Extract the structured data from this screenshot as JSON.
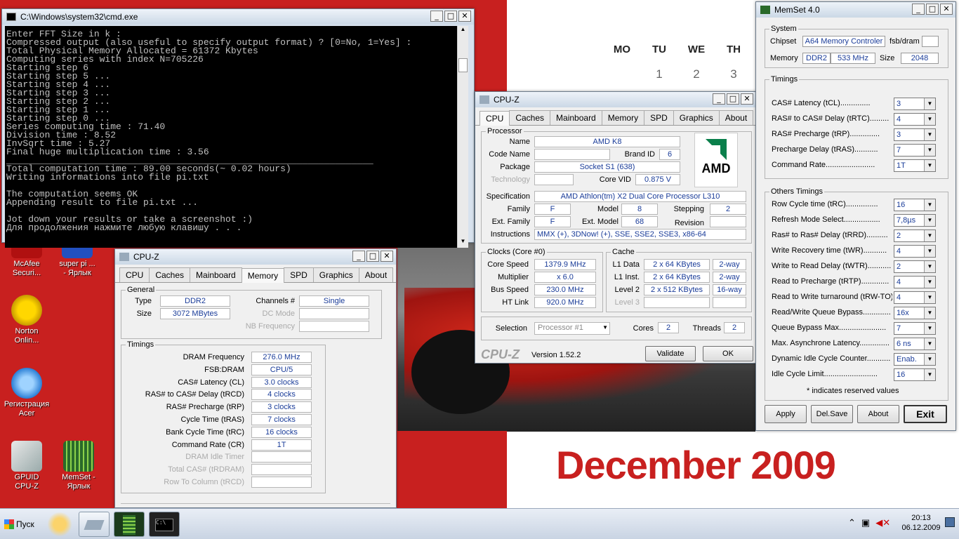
{
  "wallpaper": {
    "calendar": {
      "days": [
        "MO",
        "TU",
        "WE",
        "TH"
      ],
      "row1": [
        "1",
        "2",
        "3"
      ],
      "month": "December 2009"
    }
  },
  "desktop_icons": [
    {
      "label": "McAfee\nSecuri...",
      "icon": "mcafee-icon"
    },
    {
      "label": "super pi ...\n- Ярлык",
      "icon": "superpi-icon"
    },
    {
      "label": "Norton\nOnlin...",
      "icon": "norton-icon"
    },
    {
      "label": "Регистрация\nAcer",
      "icon": "acer-registration-icon"
    },
    {
      "label": "GPUID\nCPU-Z",
      "icon": "cpuz-icon"
    },
    {
      "label": "MemSet -\nЯрлык",
      "icon": "memset-icon"
    }
  ],
  "cmd": {
    "title": "C:\\Windows\\system32\\cmd.exe",
    "text": "Enter FFT Size in k :\nCompressed output (also useful to specify output format) ? [0=No, 1=Yes] :\nTotal Physical Memory Allocated = 61372 Kbytes\nComputing series with index N=705226\nStarting step 6\nStarting step 5 ...\nStarting step 4 ...\nStarting step 3 ...\nStarting step 2 ...\nStarting step 1 ...\nStarting step 0 ...\nSeries computing time : 71.40\nDivision time : 8.52\nInvSqrt time : 5.27\nFinal huge multiplication time : 3.56\n___________________________________________________________________\nTotal computation time : 89.00 seconds(~ 0.02 hours)\nWriting informations into file pi.txt\n\nThe computation seems OK\nAppending result to file pi.txt ...\n\nJot down your results or take a screenshot :)\nДля продолжения нажмите любую клавишу . . ."
  },
  "cpuz_mem": {
    "title": "CPU-Z",
    "tabs": [
      "CPU",
      "Caches",
      "Mainboard",
      "Memory",
      "SPD",
      "Graphics",
      "About"
    ],
    "active_tab": "Memory",
    "general_legend": "General",
    "type_label": "Type",
    "type": "DDR2",
    "size_label": "Size",
    "size": "3072 MBytes",
    "channels_label": "Channels #",
    "channels": "Single",
    "dcmode_label": "DC Mode",
    "nbfreq_label": "NB Frequency",
    "timings_legend": "Timings",
    "timings": [
      {
        "label": "DRAM Frequency",
        "value": "276.0 MHz"
      },
      {
        "label": "FSB:DRAM",
        "value": "CPU/5"
      },
      {
        "label": "CAS# Latency (CL)",
        "value": "3.0 clocks"
      },
      {
        "label": "RAS# to CAS# Delay (tRCD)",
        "value": "4 clocks"
      },
      {
        "label": "RAS# Precharge (tRP)",
        "value": "3 clocks"
      },
      {
        "label": "Cycle Time (tRAS)",
        "value": "7 clocks"
      },
      {
        "label": "Bank Cycle Time (tRC)",
        "value": "16 clocks"
      },
      {
        "label": "Command Rate (CR)",
        "value": "1T"
      },
      {
        "label": "DRAM Idle Timer",
        "value": ""
      },
      {
        "label": "Total CAS# (tRDRAM)",
        "value": ""
      },
      {
        "label": "Row To Column (tRCD)",
        "value": ""
      }
    ]
  },
  "cpuz_cpu": {
    "title": "CPU-Z",
    "tabs": [
      "CPU",
      "Caches",
      "Mainboard",
      "Memory",
      "SPD",
      "Graphics",
      "About"
    ],
    "active_tab": "CPU",
    "processor_legend": "Processor",
    "name_label": "Name",
    "name": "AMD K8",
    "codename_label": "Code Name",
    "brandid_label": "Brand ID",
    "brandid": "6",
    "package_label": "Package",
    "package": "Socket S1 (638)",
    "technology_label": "Technology",
    "corevid_label": "Core VID",
    "corevid": "0.875 V",
    "spec_label": "Specification",
    "spec": "AMD Athlon(tm) X2 Dual Core Processor L310",
    "family_label": "Family",
    "family": "F",
    "model_label": "Model",
    "model": "8",
    "stepping_label": "Stepping",
    "stepping": "2",
    "extfamily_label": "Ext. Family",
    "extfamily": "F",
    "extmodel_label": "Ext. Model",
    "extmodel": "68",
    "revision_label": "Revision",
    "instr_label": "Instructions",
    "instr": "MMX (+), 3DNow! (+), SSE, SSE2, SSE3, x86-64",
    "logo": "AMD",
    "clocks_legend": "Clocks (Core #0)",
    "corespeed_label": "Core Speed",
    "corespeed": "1379.9 MHz",
    "mult_label": "Multiplier",
    "mult": "x 6.0",
    "bus_label": "Bus Speed",
    "bus": "230.0 MHz",
    "ht_label": "HT Link",
    "ht": "920.0 MHz",
    "cache_legend": "Cache",
    "l1d_label": "L1 Data",
    "l1d": "2 x 64 KBytes",
    "l1d_way": "2-way",
    "l1i_label": "L1 Inst.",
    "l1i": "2 x 64 KBytes",
    "l1i_way": "2-way",
    "l2_label": "Level 2",
    "l2": "2 x 512 KBytes",
    "l2_way": "16-way",
    "l3_label": "Level 3",
    "selection_label": "Selection",
    "selection": "Processor #1",
    "cores_label": "Cores",
    "cores": "2",
    "threads_label": "Threads",
    "threads": "2",
    "brand": "CPU-Z",
    "version": "Version 1.52.2",
    "validate": "Validate",
    "ok": "OK"
  },
  "memset": {
    "title": "MemSet 4.0",
    "system_legend": "System",
    "chipset_label": "Chipset",
    "chipset": "A64 Memory Controler",
    "fsbdram_label": "fsb/dram",
    "memory_label": "Memory",
    "memory_type": "DDR2",
    "memory_speed": "533 MHz",
    "size_label": "Size",
    "size": "2048",
    "timings_legend": "Timings",
    "timings": [
      {
        "label": "CAS# Latency (tCL)..............",
        "value": "3"
      },
      {
        "label": "RAS# to CAS# Delay (tRTC).........",
        "value": "4"
      },
      {
        "label": "RAS# Precharge (tRP)..............",
        "value": "3"
      },
      {
        "label": "Precharge Delay  (tRAS)...........",
        "value": "7"
      },
      {
        "label": "Command Rate.......................",
        "value": "1T"
      }
    ],
    "others_legend": "Others Timings",
    "others": [
      {
        "label": "Row Cycle time (tRC)...............",
        "value": "16"
      },
      {
        "label": "Refresh Mode Select.................",
        "value": "7,8µs"
      },
      {
        "label": "Ras# to Ras# Delay (tRRD)..........",
        "value": "2"
      },
      {
        "label": "Write Recovery time (tWR)...........",
        "value": "4"
      },
      {
        "label": "Write to Read Delay (tWTR)...........",
        "value": "2"
      },
      {
        "label": "Read to Precharge (tRTP).............",
        "value": "4"
      },
      {
        "label": "Read to Write turnaround (tRW-TO)",
        "value": "4"
      },
      {
        "label": "Read/Write Queue Bypass.............",
        "value": "16x"
      },
      {
        "label": "Queue Bypass Max......................",
        "value": "7"
      },
      {
        "label": "Max. Asynchrone Latency..............",
        "value": "6 ns"
      },
      {
        "label": "Dynamic Idle Cycle Counter...........",
        "value": "Enab."
      },
      {
        "label": "Idle Cycle Limit.........................",
        "value": "16"
      }
    ],
    "note": "* indicates reserved values",
    "apply": "Apply",
    "delsave": "Del.Save",
    "about": "About",
    "exit": "Exit"
  },
  "taskbar": {
    "start": "Пуск",
    "time": "20:13",
    "date": "06.12.2009"
  }
}
